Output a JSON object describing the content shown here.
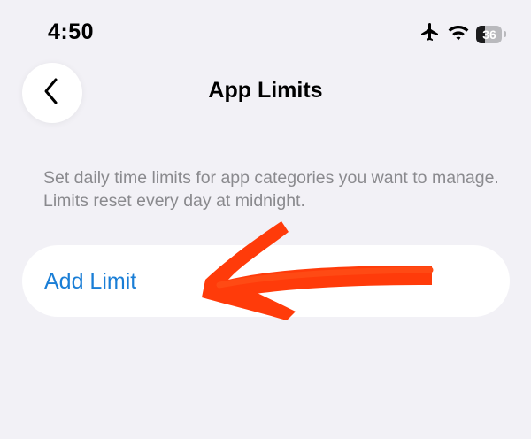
{
  "status_bar": {
    "time": "4:50",
    "battery_level": "36",
    "battery_fraction": 0.36,
    "icons": [
      "airplane-icon",
      "wifi-icon",
      "battery-icon"
    ]
  },
  "nav": {
    "back_icon": "chevron-left-icon",
    "title": "App Limits"
  },
  "description": "Set daily time limits for app categories you want to manage. Limits reset every day at midnight.",
  "add_limit": {
    "label": "Add Limit"
  },
  "annotation": {
    "type": "arrow",
    "color": "#ff3b0a",
    "points_to": "add-limit-button"
  },
  "colors": {
    "background": "#f2f1f6",
    "accent": "#1a7ed6",
    "secondary_text": "#8a8a8e",
    "card": "#ffffff"
  }
}
